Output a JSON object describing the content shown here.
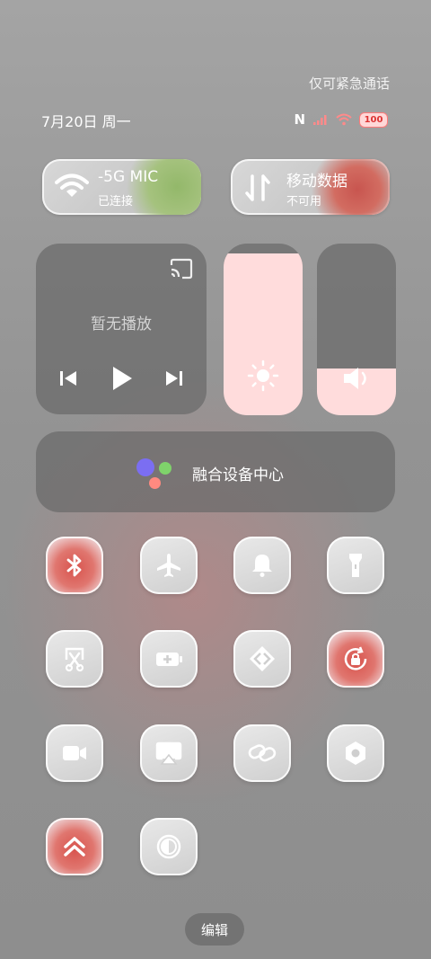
{
  "status": {
    "emergency_text": "仅可紧急通话",
    "date_text": "7月20日 周一",
    "nfc_label": "N",
    "battery_level": "100"
  },
  "quick_pills": {
    "wifi": {
      "title": "-5G      MIC",
      "subtitle": "已连接",
      "icon": "wifi-icon"
    },
    "mobile_data": {
      "title": "移动数据",
      "subtitle": "不可用",
      "icon": "mobile-data-icon"
    }
  },
  "media": {
    "state_text": "暂无播放",
    "icons": [
      "cast-icon",
      "previous-track-icon",
      "play-icon",
      "next-track-icon"
    ]
  },
  "sliders": {
    "brightness": {
      "icon": "sun-icon",
      "level": 0.94
    },
    "volume": {
      "icon": "speaker-icon",
      "level": 0.27
    }
  },
  "device_center": {
    "label": "融合设备中心"
  },
  "toggles": [
    {
      "icon": "bluetooth-icon",
      "active": true
    },
    {
      "icon": "airplane-icon",
      "active": false
    },
    {
      "icon": "bell-icon",
      "active": false
    },
    {
      "icon": "flashlight-icon",
      "active": false
    },
    {
      "icon": "screenshot-cut-icon",
      "active": false
    },
    {
      "icon": "battery-saver-icon",
      "active": false
    },
    {
      "icon": "nearby-share-icon",
      "active": false
    },
    {
      "icon": "rotation-lock-icon",
      "active": true
    },
    {
      "icon": "screen-record-icon",
      "active": false
    },
    {
      "icon": "cast-screen-icon",
      "active": false
    },
    {
      "icon": "link-icon",
      "active": false
    },
    {
      "icon": "settings-hex-icon",
      "active": false
    },
    {
      "icon": "double-chevron-up-icon",
      "active": true
    },
    {
      "icon": "dark-mode-icon",
      "active": false
    }
  ],
  "colors": {
    "active_tile": "#d8534d",
    "slider_fill": "#ffdcdc",
    "panel": "#696969",
    "dot_blue": "#7b6ef2",
    "dot_green": "#7fd36b",
    "dot_pink": "#ff8a80"
  },
  "edit_button": {
    "label": "编辑"
  }
}
